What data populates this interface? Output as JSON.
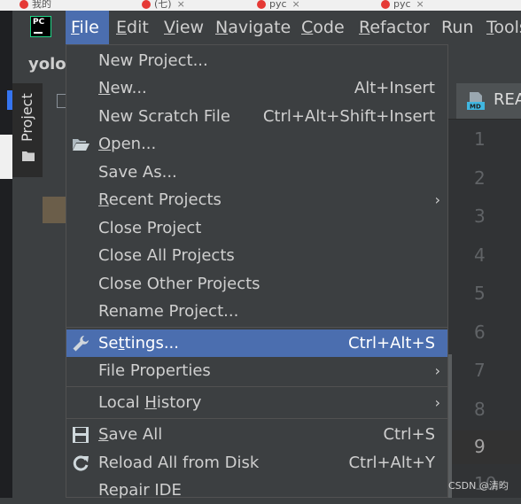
{
  "browser_tabs": [
    {
      "label": "我的",
      "close": "×"
    },
    {
      "label": "(七)",
      "close": "×"
    },
    {
      "label": "pyc",
      "close": "×"
    },
    {
      "label": "pyc",
      "close": "×"
    }
  ],
  "app": {
    "logo_text": "PC"
  },
  "menubar": {
    "items": [
      {
        "label": "File",
        "u": "F",
        "rest": "ile"
      },
      {
        "label": "Edit",
        "u": "E",
        "rest": "dit"
      },
      {
        "label": "View",
        "u": "V",
        "rest": "iew"
      },
      {
        "label": "Navigate",
        "u": "N",
        "rest": "avigate"
      },
      {
        "label": "Code",
        "u": "C",
        "rest": "ode"
      },
      {
        "label": "Refactor",
        "u": "R",
        "rest": "efactor"
      },
      {
        "label": "Run",
        "u": "",
        "rest": "Run"
      },
      {
        "label": "Tools",
        "u": "T",
        "rest": "ools"
      }
    ]
  },
  "project": {
    "name": "yolo",
    "side_tab": "Project"
  },
  "editor": {
    "tab_label": "REA",
    "md_badge": "MD",
    "line_numbers": [
      "1",
      "2",
      "3",
      "4",
      "5",
      "6",
      "7",
      "8",
      "9",
      "10"
    ],
    "current_line": "9"
  },
  "file_menu": {
    "items": [
      {
        "pre": "New Project...",
        "u": "",
        "post": "",
        "shortcut": ""
      },
      {
        "pre": "",
        "u": "N",
        "post": "ew...",
        "shortcut": "Alt+Insert"
      },
      {
        "pre": "New Scratch File",
        "u": "",
        "post": "",
        "shortcut": "Ctrl+Alt+Shift+Insert"
      },
      {
        "pre": "",
        "u": "O",
        "post": "pen...",
        "shortcut": ""
      },
      {
        "pre": "Save As...",
        "u": "",
        "post": "",
        "shortcut": ""
      },
      {
        "pre": "",
        "u": "R",
        "post": "ecent Projects",
        "shortcut": ""
      },
      {
        "pre": "Close Project",
        "u": "",
        "post": "",
        "shortcut": ""
      },
      {
        "pre": "Close All Projects",
        "u": "",
        "post": "",
        "shortcut": ""
      },
      {
        "pre": "Close Other Projects",
        "u": "",
        "post": "",
        "shortcut": ""
      },
      {
        "pre": "Rename Project...",
        "u": "",
        "post": "",
        "shortcut": ""
      },
      {
        "pre": "Se",
        "u": "t",
        "post": "tings...",
        "shortcut": "Ctrl+Alt+S"
      },
      {
        "pre": "File Properties",
        "u": "",
        "post": "",
        "shortcut": ""
      },
      {
        "pre": "Local ",
        "u": "H",
        "post": "istory",
        "shortcut": ""
      },
      {
        "pre": "",
        "u": "S",
        "post": "ave All",
        "shortcut": "Ctrl+S"
      },
      {
        "pre": "Reload All from Disk",
        "u": "",
        "post": "",
        "shortcut": "Ctrl+Alt+Y"
      },
      {
        "pre": "Repair IDE",
        "u": "",
        "post": "",
        "shortcut": ""
      }
    ],
    "submenu_arrow": "›"
  },
  "watermark": "CSDN @清昀",
  "colors": {
    "accent": "#4b6eaf",
    "background": "#3c3f41",
    "editor_gutter": "#313335",
    "logo_border": "#21d789"
  }
}
